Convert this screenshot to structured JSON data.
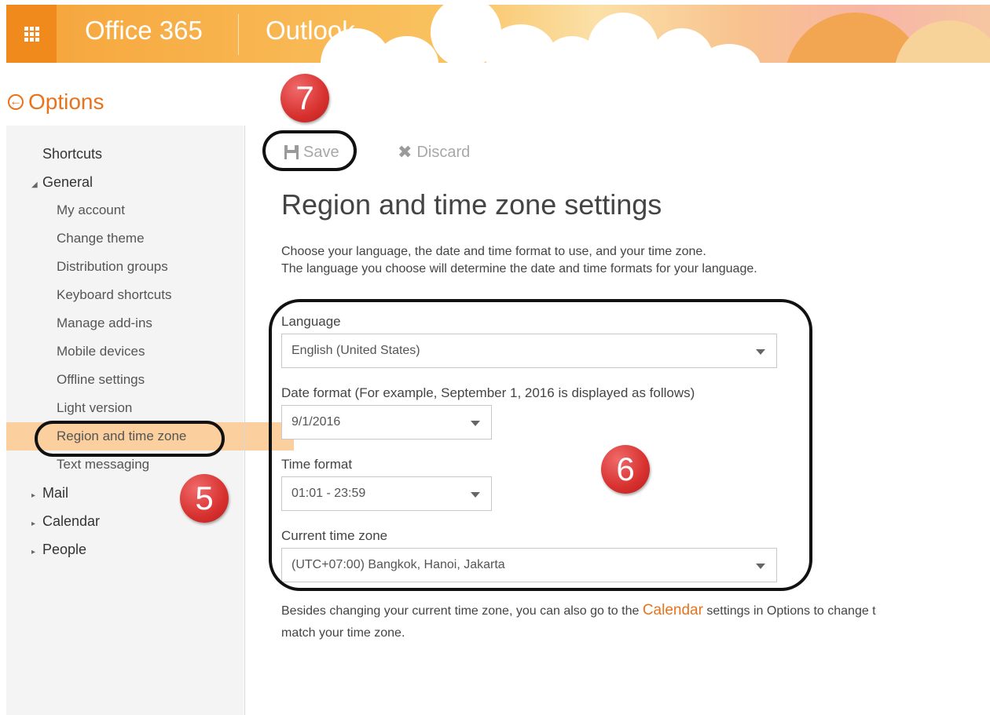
{
  "header": {
    "brand": "Office 365",
    "app_name": "Outlook"
  },
  "nav": {
    "title": "Options",
    "items": [
      {
        "label": "Shortcuts"
      },
      {
        "label": "General"
      },
      {
        "label": "My account"
      },
      {
        "label": "Change theme"
      },
      {
        "label": "Distribution groups"
      },
      {
        "label": "Keyboard shortcuts"
      },
      {
        "label": "Manage add-ins"
      },
      {
        "label": "Mobile devices"
      },
      {
        "label": "Offline settings"
      },
      {
        "label": "Light version"
      },
      {
        "label": "Region and time zone"
      },
      {
        "label": "Text messaging"
      },
      {
        "label": "Mail"
      },
      {
        "label": "Calendar"
      },
      {
        "label": "People"
      }
    ],
    "selected": "Region and time zone"
  },
  "toolbar": {
    "save_label": "Save",
    "discard_label": "Discard"
  },
  "main": {
    "title": "Region and time zone settings",
    "desc_line1": "Choose your language, the date and time format to use, and your time zone.",
    "desc_line2": "The language you choose will determine the date and time formats for your language.",
    "language": {
      "label": "Language",
      "value": "English (United States)"
    },
    "date_format": {
      "label": "Date format (For example, September 1, 2016 is displayed as follows)",
      "value": "9/1/2016"
    },
    "time_format": {
      "label": "Time format",
      "value": "01:01 - 23:59"
    },
    "time_zone": {
      "label": "Current time zone",
      "value": "(UTC+07:00) Bangkok, Hanoi, Jakarta"
    },
    "footer_before": "Besides changing your current time zone, you can also go to the ",
    "footer_link": "Calendar",
    "footer_after": " settings in Options to change t",
    "footer_line2": "match your time zone."
  },
  "annotations": {
    "badge_5": "5",
    "badge_6": "6",
    "badge_7": "7"
  },
  "colors": {
    "accent": "#e8731c",
    "selected_bg": "#fbcf9e",
    "badge_red": "#d7312f"
  }
}
